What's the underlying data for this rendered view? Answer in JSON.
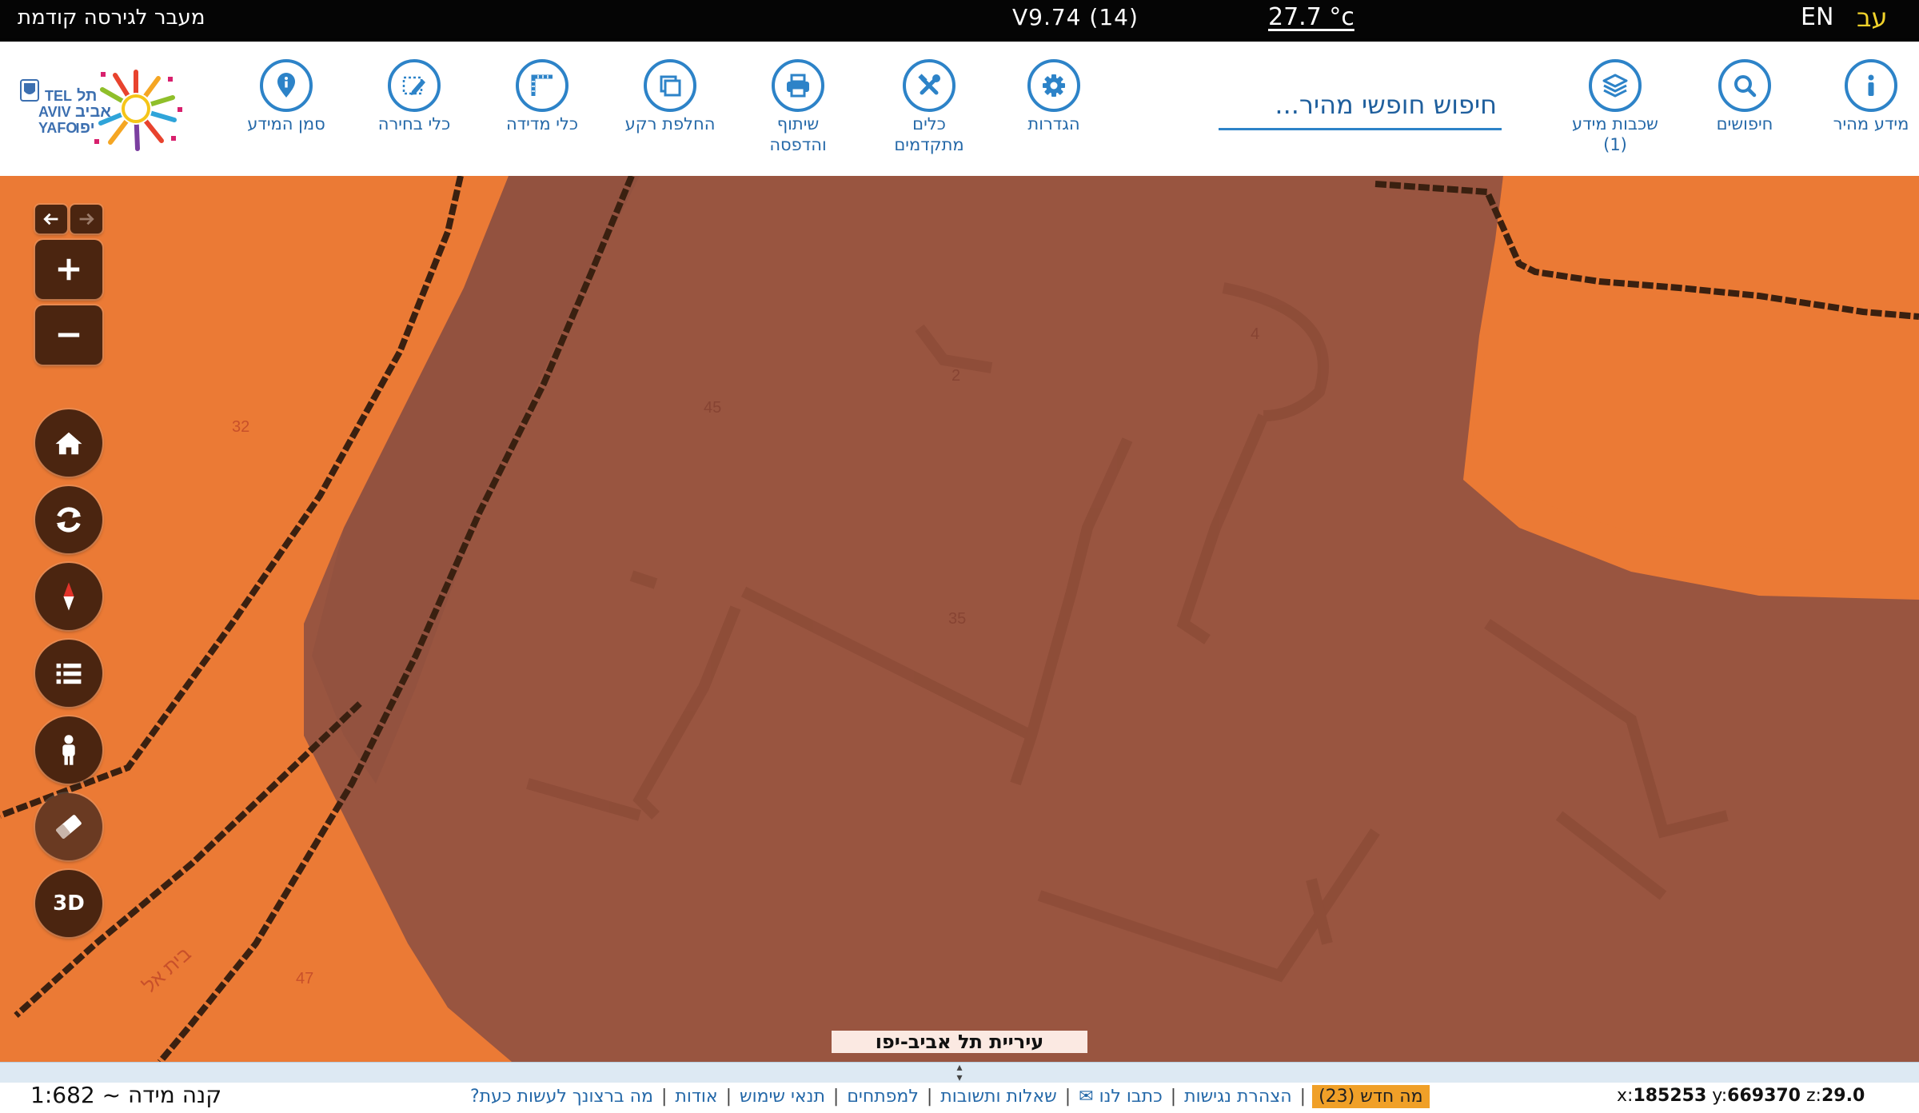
{
  "topbar": {
    "prev_version_link": "מעבר לגירסה קודמת",
    "version": "V9.74 (14)",
    "temperature": "27.7 °c",
    "lang_en": "EN",
    "lang_he": "עב"
  },
  "toolbar": {
    "quick_info": "מידע מהיר",
    "searches": "חיפושים",
    "info_layers": "שכבות מידע",
    "info_layers_count": "(1)",
    "search_placeholder": "חיפוש חופשי מהיר...",
    "settings": "הגדרות",
    "advanced_tools_1": "כלים",
    "advanced_tools_2": "מתקדמים",
    "share_print_1": "שיתוף",
    "share_print_2": "והדפסה",
    "switch_basemap": "החלפת רקע",
    "measure_tools": "כלי מדידה",
    "selection_tools": "כלי בחירה",
    "info_marker": "סמן המידע",
    "logo_text_en_1": "TEL",
    "logo_text_en_2": "AVIV",
    "logo_text_en_3": "YAFO",
    "logo_text_he_1": "תל",
    "logo_text_he_2": "אביב",
    "logo_text_he_3": "יפו"
  },
  "map": {
    "city_label": "עיריית תל אביב-יפו",
    "street_name": "בית אל",
    "parcel_numbers": [
      "32",
      "45",
      "2",
      "4",
      "35",
      "47"
    ]
  },
  "controls": {
    "three_d": "3D"
  },
  "footer": {
    "scale": "קנה מידה ~ 1:682",
    "links": [
      "מה ברצונך לעשות כעת?",
      "אודות",
      "תנאי שימוש",
      "למפתחים",
      "שאלות ותשובות",
      "כתבו לנו ✉",
      "הצהרת נגישות"
    ],
    "whats_new": "מה חדש (23)",
    "x_label": "x:",
    "x_value": "185253",
    "y_label": "y:",
    "y_value": "669370",
    "z_label": "z:",
    "z_value": "29.0"
  },
  "colors": {
    "map_orange": "#eb7a35",
    "map_brown": "#995540",
    "control_brown": "#4b2510",
    "toolbar_blue": "#2d83c8",
    "lang_active": "#f1d22a",
    "whats_new_bg": "#f0a028"
  }
}
